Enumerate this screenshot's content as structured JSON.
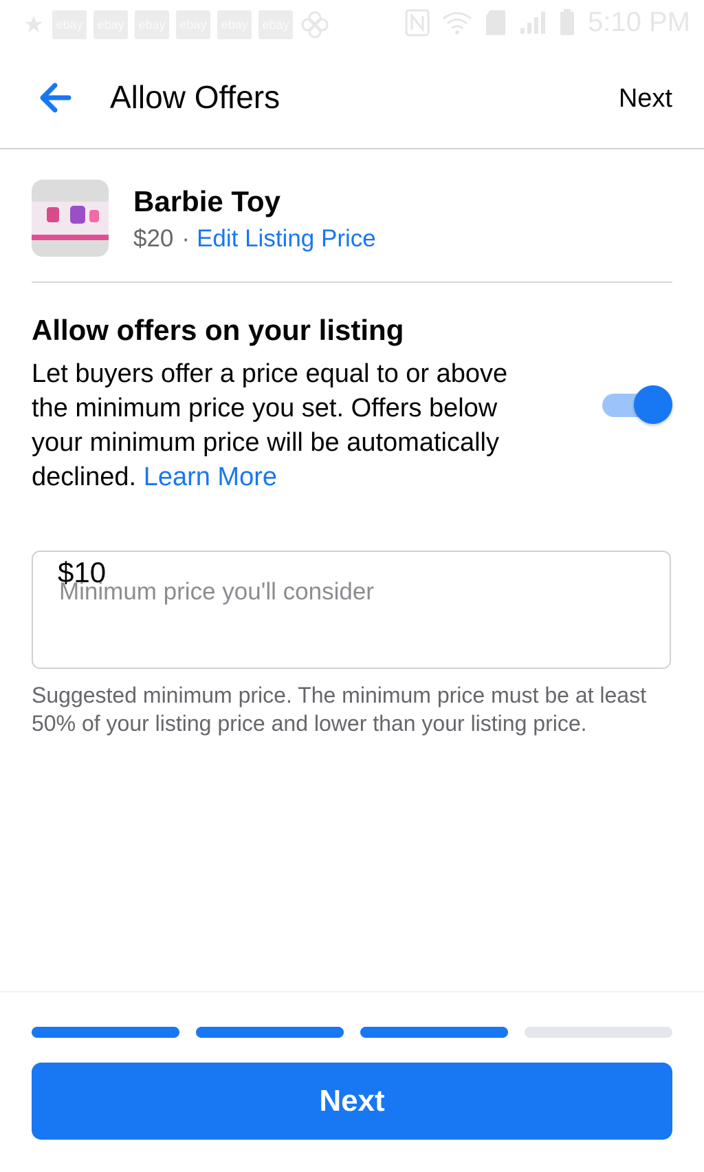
{
  "status_bar": {
    "time": "5:10 PM",
    "notification_icons": [
      "star-icon",
      "ebay-icon",
      "ebay-icon",
      "ebay-icon",
      "ebay-icon",
      "ebay-icon",
      "ebay-icon",
      "pinwheel-icon"
    ],
    "ebay_label": "ebay",
    "system_icons": [
      "nfc-icon",
      "wifi-icon",
      "sd-card-icon",
      "signal-icon",
      "battery-icon"
    ]
  },
  "header": {
    "title": "Allow Offers",
    "next_label": "Next",
    "back_icon": "arrow-left-icon"
  },
  "listing": {
    "name": "Barbie Toy",
    "price": "$20",
    "separator": "·",
    "edit_link": "Edit Listing Price"
  },
  "offers": {
    "heading": "Allow offers on your listing",
    "description": "Let buyers offer a price equal to or above the minimum price you set. Offers below your minimum price will be automatically declined.",
    "learn_more": "Learn More",
    "toggle_on": true
  },
  "min_price": {
    "value": "$10",
    "placeholder": "Minimum price you'll consider",
    "helper": "Suggested minimum price. The minimum price must be at least 50% of your listing price and lower than your listing price."
  },
  "progress": {
    "total_steps": 4,
    "completed_steps": 3
  },
  "footer": {
    "next_button": "Next"
  },
  "colors": {
    "accent": "#1877f2",
    "accent_light": "#9cc4fb",
    "text_primary": "#050505",
    "text_secondary": "#65676b"
  }
}
